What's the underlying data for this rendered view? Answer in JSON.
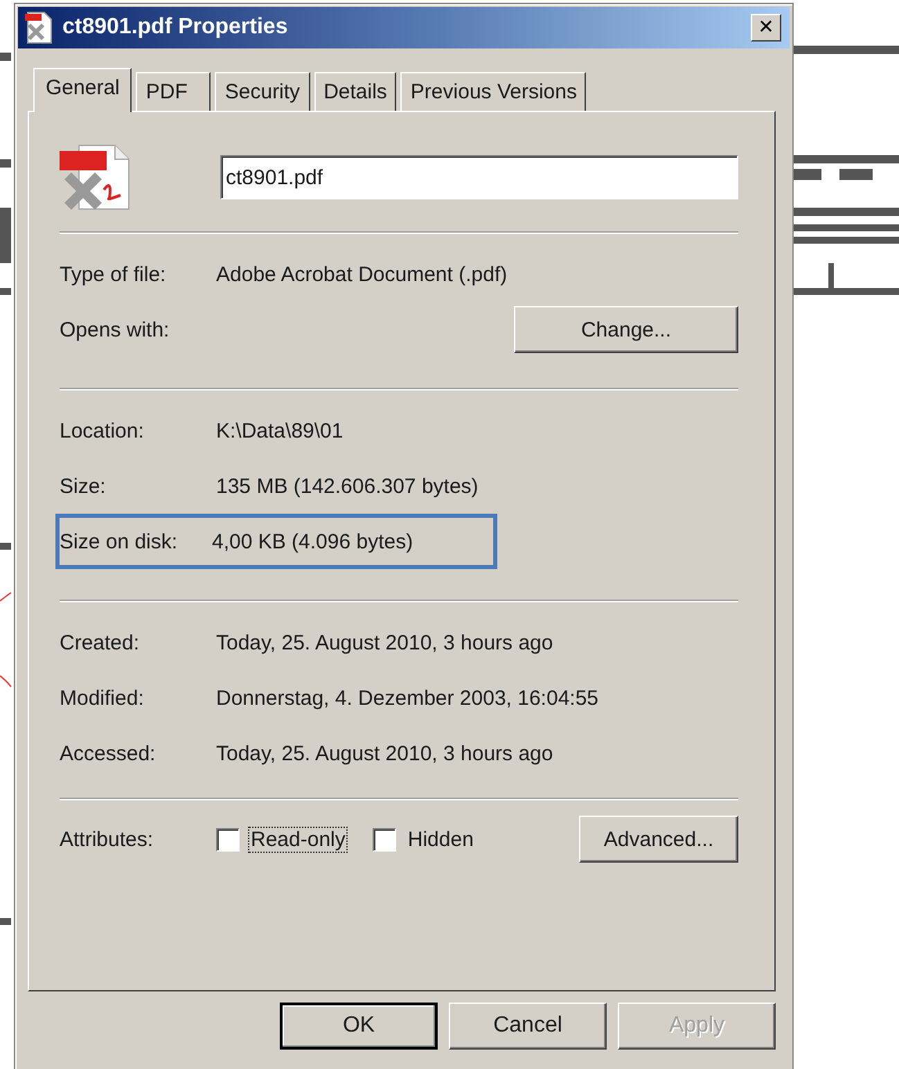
{
  "window": {
    "title": "ct8901.pdf Properties",
    "close": "✕"
  },
  "tabs": [
    {
      "label": "General",
      "selected": true
    },
    {
      "label": "PDF",
      "selected": false
    },
    {
      "label": "Security",
      "selected": false
    },
    {
      "label": "Details",
      "selected": false
    },
    {
      "label": "Previous Versions",
      "selected": false
    }
  ],
  "file_name": {
    "value": "ct8901.pdf"
  },
  "groups": [
    {
      "rows": [
        {
          "kind": "info",
          "label": "Type of file:",
          "value": "Adobe Acrobat Document (.pdf)"
        },
        {
          "kind": "action",
          "label": "Opens with:",
          "button": "Change..."
        }
      ]
    },
    {
      "rows": [
        {
          "kind": "info",
          "label": "Location:",
          "value": "K:\\Data\\89\\01"
        },
        {
          "kind": "info",
          "label": "Size:",
          "value": "135 MB (142.606.307 bytes)"
        },
        {
          "kind": "info",
          "label": "Size on disk:",
          "value": "4,00 KB (4.096 bytes)",
          "highlighted": true
        }
      ]
    },
    {
      "rows": [
        {
          "kind": "info",
          "label": "Created:",
          "value": "Today, 25. August 2010, 3 hours ago"
        },
        {
          "kind": "info",
          "label": "Modified:",
          "value": "Donnerstag, 4. Dezember 2003, 16:04:55"
        },
        {
          "kind": "info",
          "label": "Accessed:",
          "value": "Today, 25. August 2010, 3 hours ago"
        }
      ]
    }
  ],
  "attributes": {
    "label": "Attributes:",
    "checkboxes": [
      {
        "label": "Read-only",
        "checked": false,
        "focused": true
      },
      {
        "label": "Hidden",
        "checked": false,
        "focused": false
      }
    ],
    "button": "Advanced..."
  },
  "buttons": [
    {
      "label": "OK",
      "default": true,
      "disabled": false
    },
    {
      "label": "Cancel",
      "default": false,
      "disabled": false
    },
    {
      "label": "Apply",
      "default": false,
      "disabled": true
    }
  ]
}
